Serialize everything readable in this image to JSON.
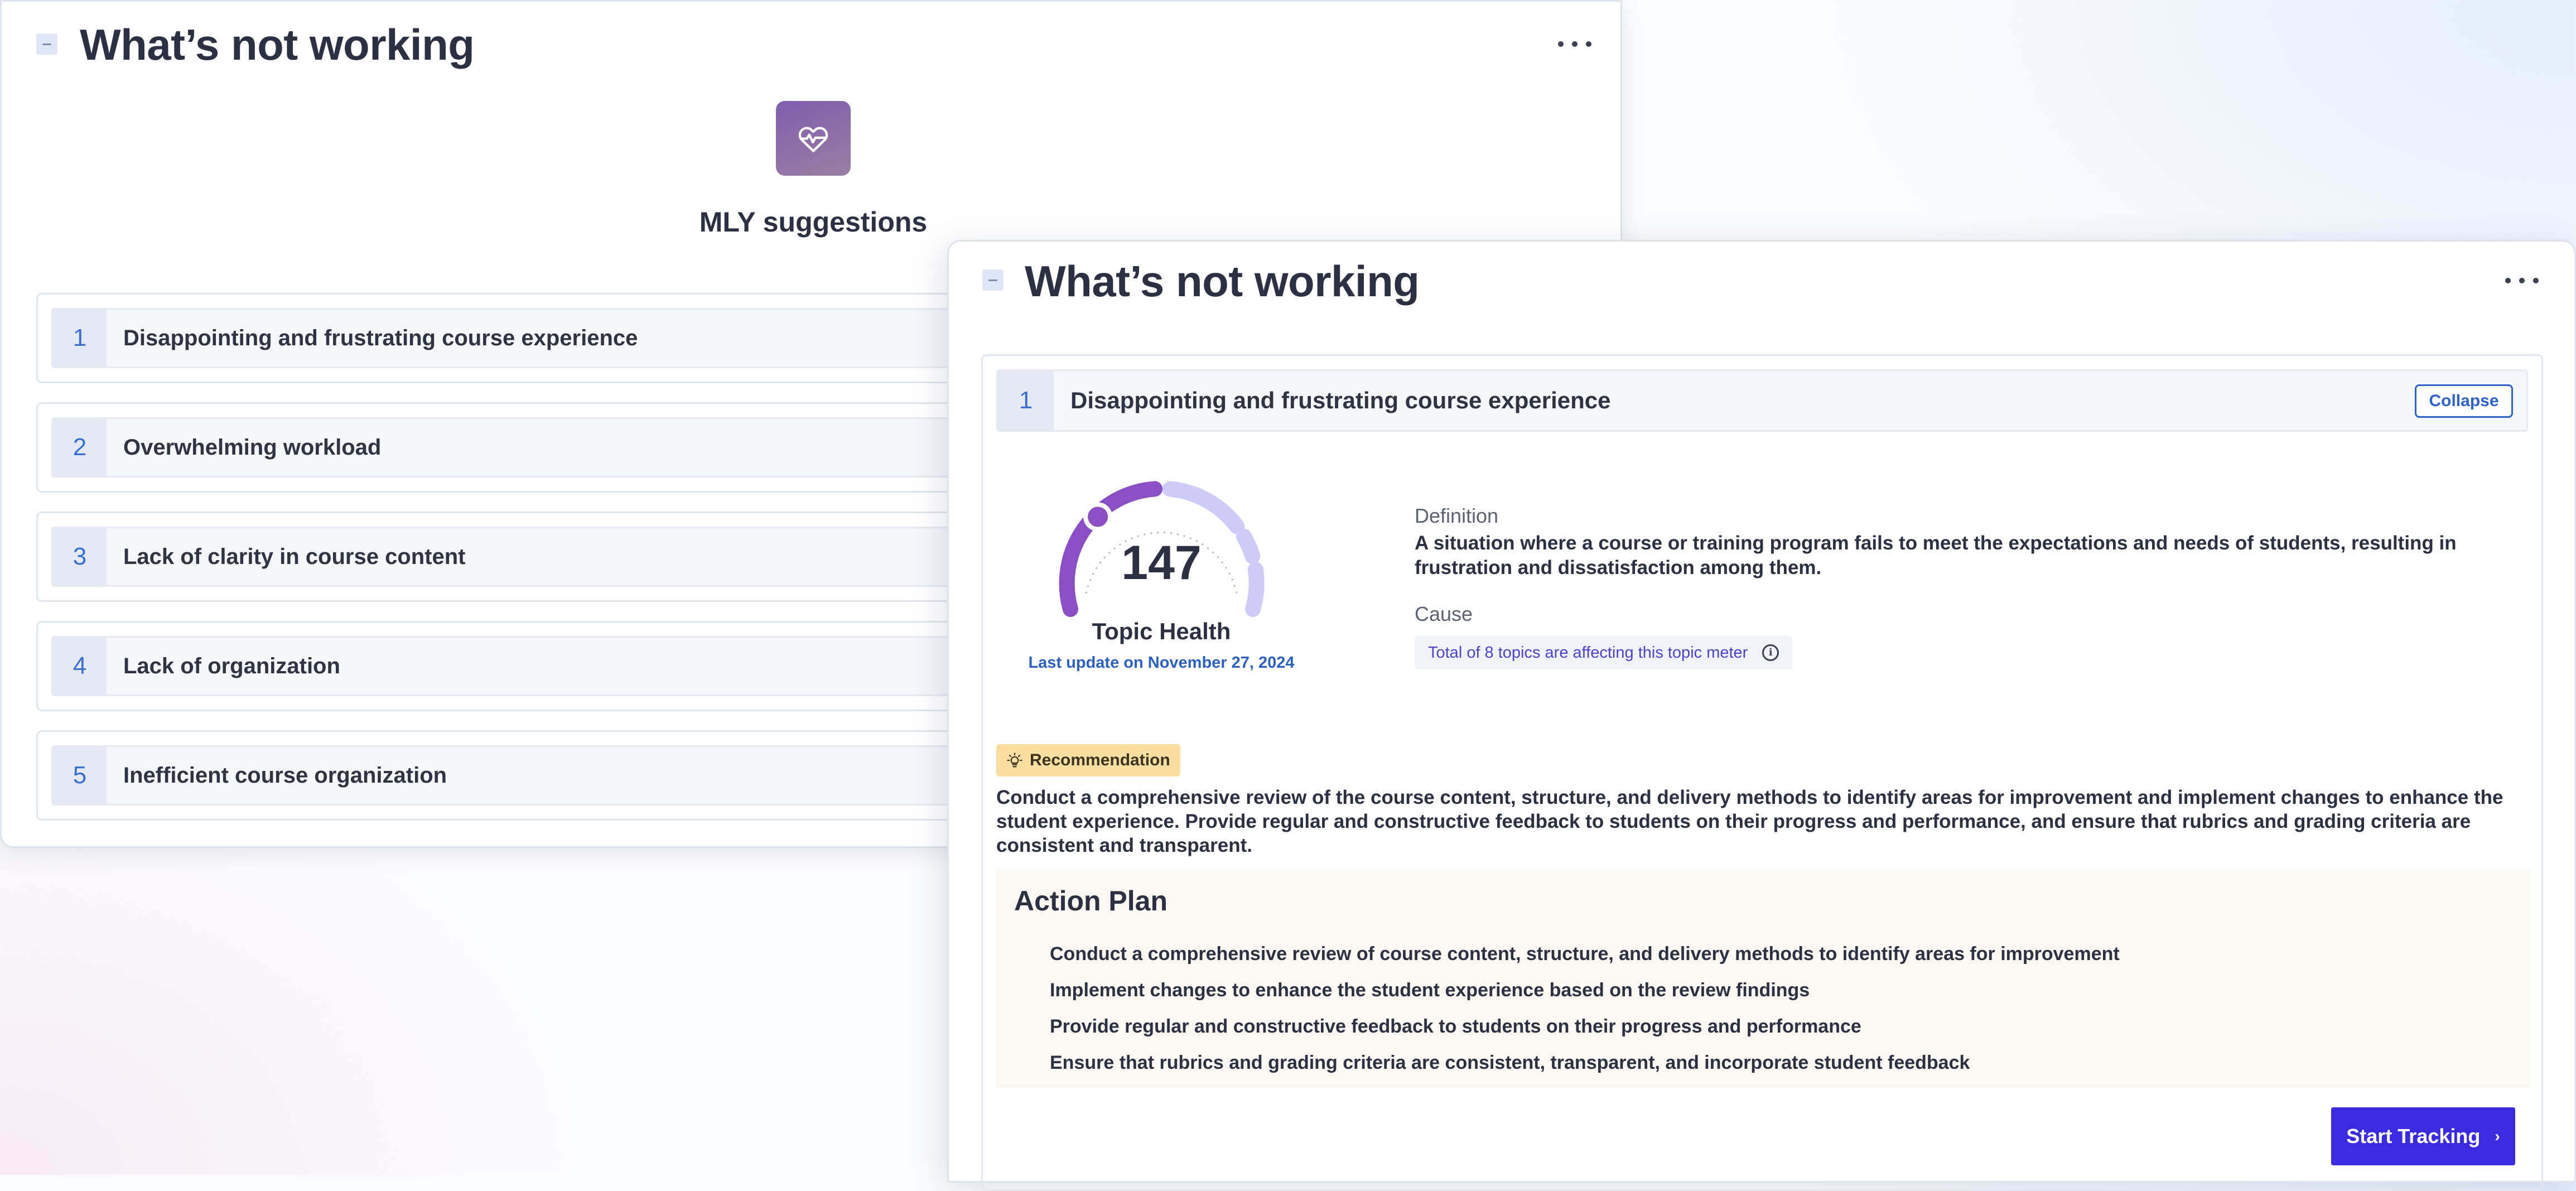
{
  "back_card": {
    "title": "What’s not working",
    "logo_icon": "heart-pulse-icon",
    "suggestions_title": "MLY suggestions",
    "topics": [
      {
        "num": "1",
        "label": "Disappointing and frustrating course experience"
      },
      {
        "num": "2",
        "label": "Overwhelming workload"
      },
      {
        "num": "3",
        "label": "Lack of clarity in course content"
      },
      {
        "num": "4",
        "label": "Lack of organization"
      },
      {
        "num": "5",
        "label": "Inefficient course organization"
      }
    ]
  },
  "front_card": {
    "title": "What’s not working",
    "topic": {
      "num": "1",
      "label": "Disappointing and frustrating course experience"
    },
    "collapse_label": "Collapse",
    "gauge": {
      "value": "147",
      "caption": "Topic Health",
      "last_update": "Last update on November 27, 2024",
      "colors": {
        "fill": "#8b4fc4",
        "track": "#cfcbf7"
      }
    },
    "definition_label": "Definition",
    "definition_text": "A situation where a course or training program fails to meet the expectations and needs of students, resulting in frustration and dissatisfaction among them.",
    "cause_label": "Cause",
    "cause_chip": "Total of 8 topics are affecting this topic meter",
    "recommendation_label": "Recommendation",
    "recommendation_text": "Conduct a comprehensive review of the course content, structure, and delivery methods to identify areas for improvement and implement changes to enhance the student experience. Provide regular and constructive feedback to students on their progress and performance, and ensure that rubrics and grading criteria are consistent and transparent.",
    "action_plan_title": "Action Plan",
    "action_items": [
      "Conduct a comprehensive review of course content, structure, and delivery methods to identify areas for improvement",
      "Implement changes to enhance the student experience based on the review findings",
      "Provide regular and constructive feedback to students on their progress and performance",
      "Ensure that rubrics and grading criteria are consistent, transparent, and incorporate student feedback"
    ],
    "start_button_label": "Start Tracking"
  },
  "colors": {
    "accent": "#3a2be0",
    "link_blue": "#2d5fbf",
    "recommendation_bg": "#f8dea0",
    "action_plan_bg": "#fbf7f3"
  }
}
